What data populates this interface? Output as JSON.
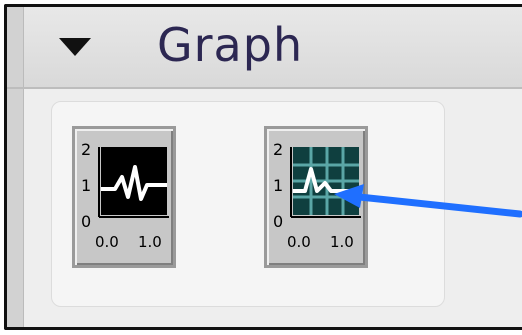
{
  "palette": {
    "title_header": "Graph",
    "collapse_symbol": "disclosure-triangle-down",
    "items": [
      {
        "icon": "waveform-graph-icon",
        "y_ticks": [
          "2",
          "1",
          "0"
        ],
        "x_ticks": [
          "0.0",
          "1.0"
        ]
      },
      {
        "icon": "waveform-graph-grid-icon",
        "y_ticks": [
          "2",
          "1",
          "0"
        ],
        "x_ticks": [
          "0.0",
          "1.0"
        ]
      }
    ]
  },
  "annotation": {
    "color": "#1f6fff"
  },
  "colors": {
    "title": "#2c2752",
    "plot_black": "#000000",
    "plot_teal": "#0f3f3f",
    "grid": "#5aa6a6"
  }
}
